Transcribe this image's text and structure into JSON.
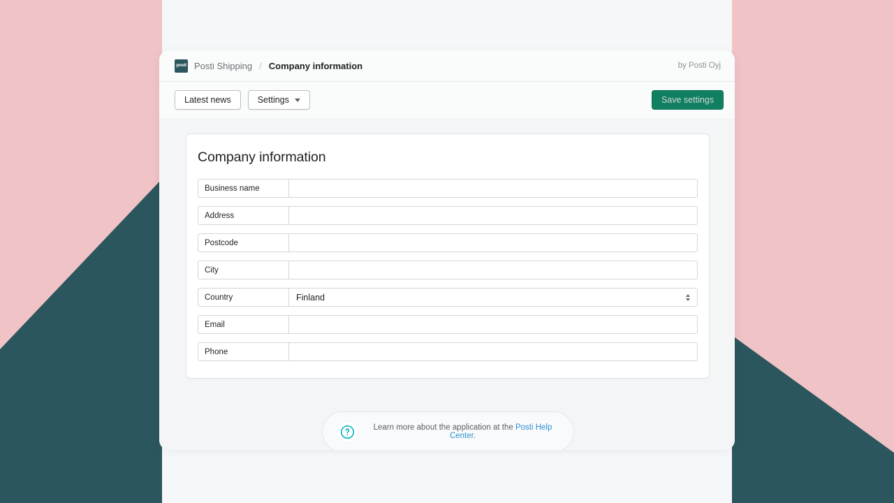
{
  "theme": {
    "pink": "#f0c3c6",
    "teal": "#2c565d",
    "save_button_green": "#108060",
    "help_icon_cyan": "#00b0ba",
    "link_blue": "#2c8fd6",
    "page_background": "#f4f5f7"
  },
  "header": {
    "logo_text": "posti",
    "app_name": "Posti Shipping",
    "separator": "/",
    "page_name": "Company information",
    "byline": "by Posti Oyj"
  },
  "toolbar": {
    "latest_news_label": "Latest news",
    "settings_label": "Settings",
    "save_label": "Save settings"
  },
  "card": {
    "title": "Company information",
    "fields": [
      {
        "label": "Business name",
        "value": "",
        "placeholder": "",
        "type": "text"
      },
      {
        "label": "Address",
        "value": "",
        "placeholder": "",
        "type": "text"
      },
      {
        "label": "Postcode",
        "value": "",
        "placeholder": "",
        "type": "text"
      },
      {
        "label": "City",
        "value": "",
        "placeholder": "",
        "type": "text"
      },
      {
        "label": "Country",
        "value": "Finland",
        "placeholder": "",
        "type": "select"
      },
      {
        "label": "Email",
        "value": "",
        "placeholder": "",
        "type": "text"
      },
      {
        "label": "Phone",
        "value": "",
        "placeholder": "",
        "type": "text"
      }
    ]
  },
  "footer": {
    "icon": "question-mark-circle-icon",
    "text_before": "Learn more about the application at the ",
    "link_text": "Posti Help Center",
    "text_after": "."
  }
}
